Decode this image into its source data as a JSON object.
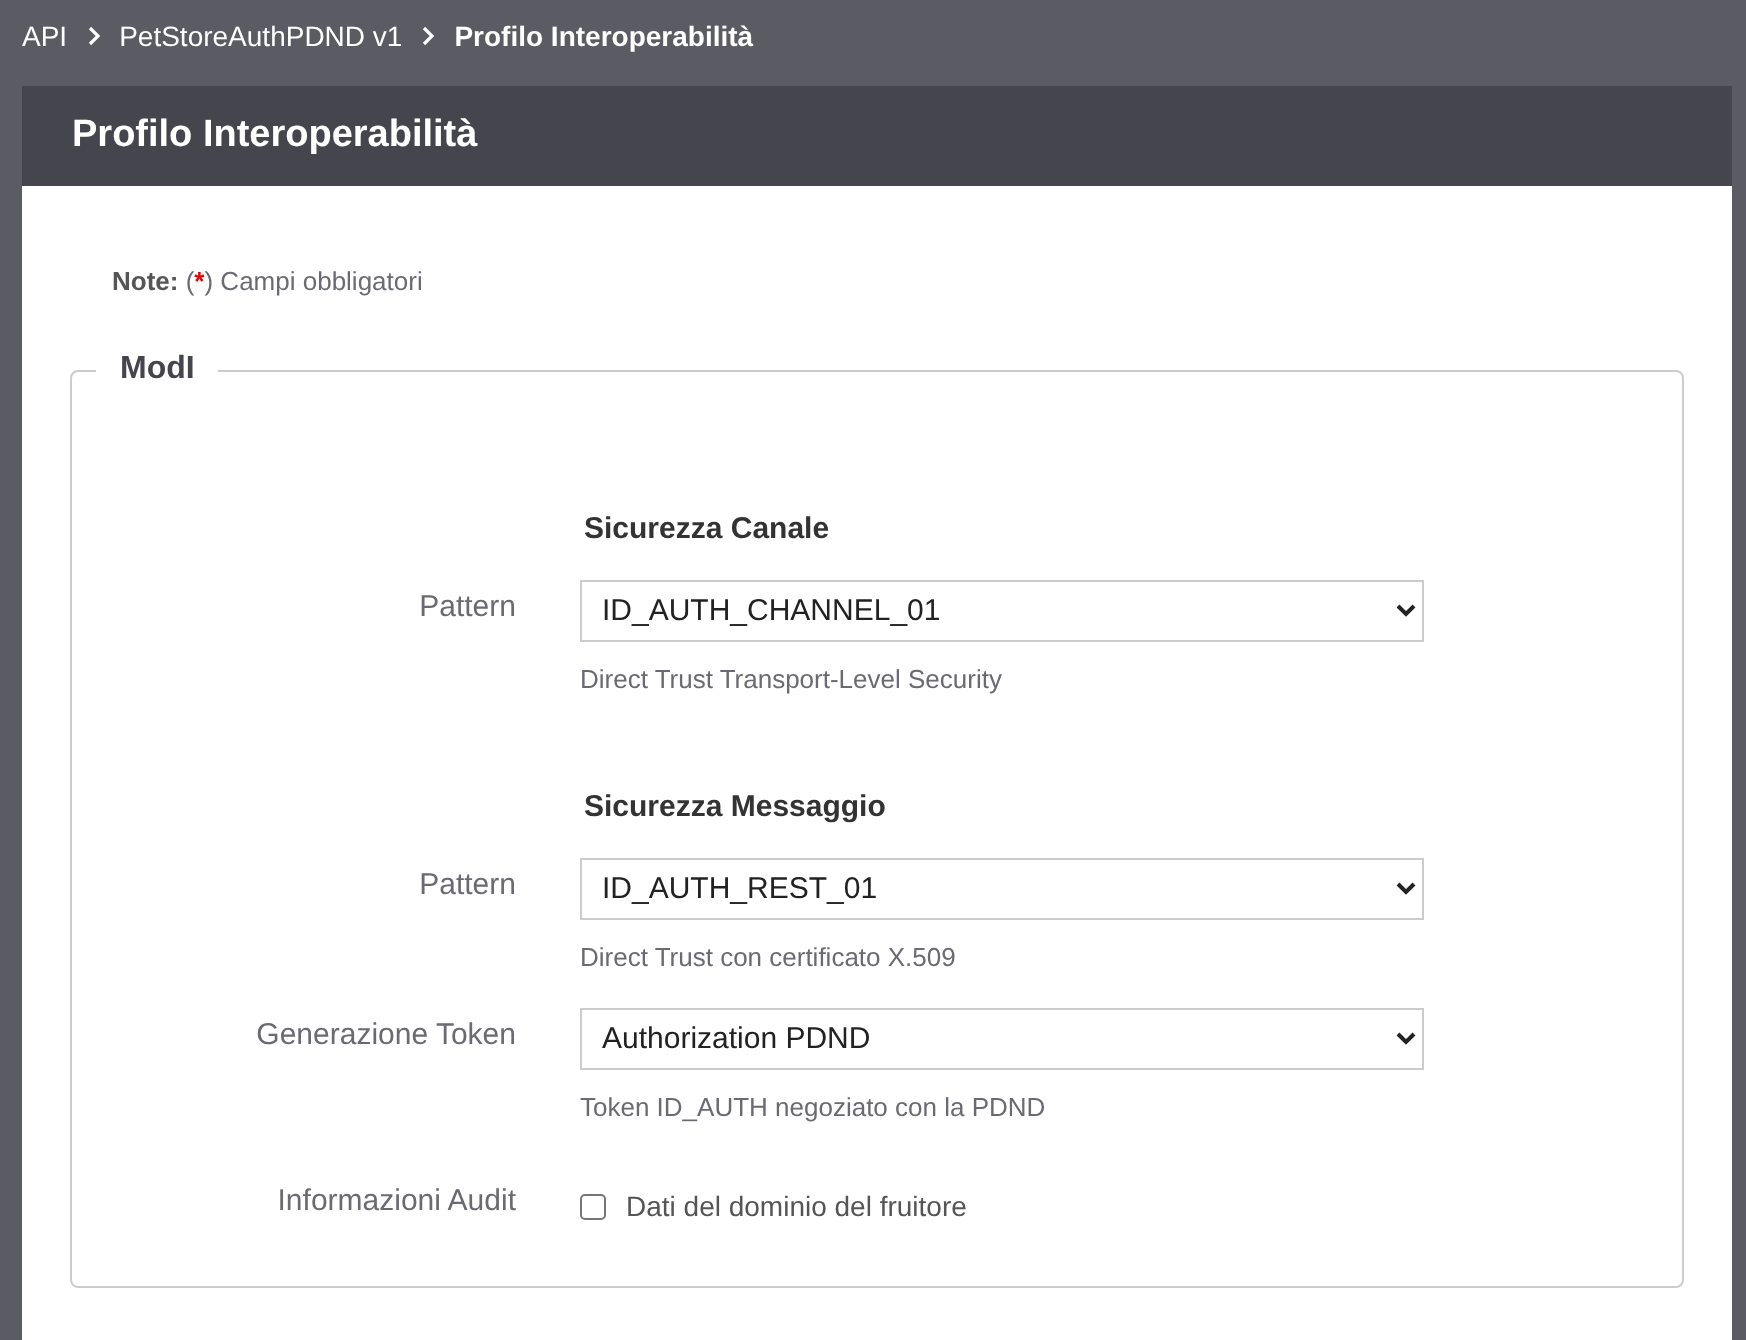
{
  "breadcrumb": [
    {
      "text": "API",
      "current": false
    },
    {
      "text": "PetStoreAuthPDND v1",
      "current": false
    },
    {
      "text": "Profilo Interoperabilità",
      "current": true
    }
  ],
  "panel": {
    "title": "Profilo Interoperabilità"
  },
  "note": {
    "label": "Note:",
    "prefix": "(",
    "mark": "*",
    "text": ") Campi obbligatori"
  },
  "fieldset": {
    "legend": "ModI",
    "rows": [
      {
        "kind": "heading",
        "text": "Sicurezza Canale"
      },
      {
        "kind": "select",
        "label": "Pattern",
        "value": "ID_AUTH_CHANNEL_01",
        "help": "Direct Trust Transport-Level Security"
      },
      {
        "kind": "heading",
        "text": "Sicurezza Messaggio"
      },
      {
        "kind": "select",
        "label": "Pattern",
        "value": "ID_AUTH_REST_01",
        "help": "Direct Trust con certificato X.509"
      },
      {
        "kind": "select",
        "label": "Generazione Token",
        "value": "Authorization PDND",
        "help": "Token ID_AUTH negoziato con la PDND"
      },
      {
        "kind": "checkbox",
        "label": "Informazioni Audit",
        "text": "Dati del dominio del fruitore",
        "checked": false
      }
    ]
  }
}
